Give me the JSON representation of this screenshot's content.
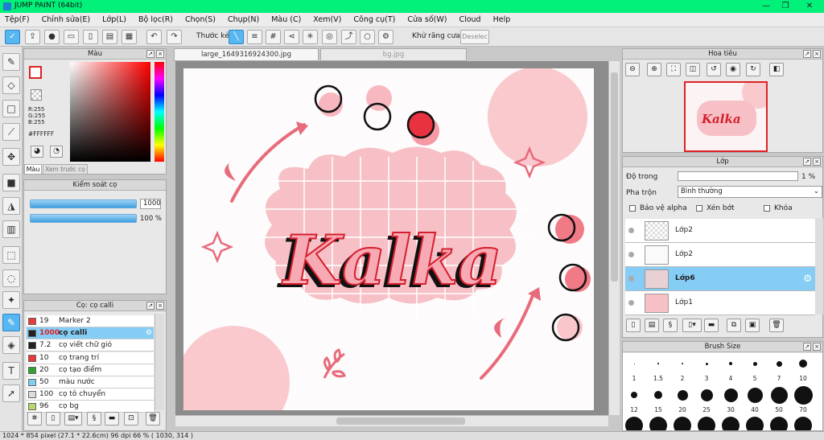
{
  "window": {
    "title": "JUMP PAINT (64bit)"
  },
  "menu": [
    "Tệp(F)",
    "Chỉnh sửa(E)",
    "Lớp(L)",
    "Bộ lọc(R)",
    "Chọn(S)",
    "Chụp(N)",
    "Màu (C)",
    "Xem(V)",
    "Công cụ(T)",
    "Cửa số(W)",
    "Cloud",
    "Help"
  ],
  "toolbar": {
    "ruler_label": "Thước kẻ",
    "antialias_label": "Khử răng cưa",
    "deselect_label": "Deselec"
  },
  "tabs": {
    "active": "large_1649316924300.jpg",
    "inactive": "bg.jpg"
  },
  "color_panel": {
    "title": "Màu",
    "r": "R:255",
    "g": "G:255",
    "b": "B:255",
    "hex": "#FFFFFF",
    "tab1": "Màu",
    "tab2": "Xem trước cọ"
  },
  "brush_control": {
    "title": "Kiểm soát cọ",
    "size": "1000",
    "opacity": "100 %"
  },
  "brush_list": {
    "title": "Cọ: cọ calli",
    "items": [
      {
        "size": "19",
        "name": "Marker 2",
        "color": "#e83a3a"
      },
      {
        "size": "1000",
        "name": "cọ calli",
        "color": "#222222"
      },
      {
        "size": "7.2",
        "name": "cọ viết chữ gió",
        "color": "#222222"
      },
      {
        "size": "10",
        "name": "cọ trang trí",
        "color": "#e83a3a"
      },
      {
        "size": "20",
        "name": "cọ tạo điểm",
        "color": "#2ea12e"
      },
      {
        "size": "50",
        "name": "màu nước",
        "color": "#7fd0f0"
      },
      {
        "size": "100",
        "name": "cọ tô chuyển",
        "color": "#dddddd"
      },
      {
        "size": "96",
        "name": "cọ bg",
        "color": "#b8d86a"
      }
    ]
  },
  "navigator": {
    "title": "Hoa tiêu",
    "thumb_text": "Kalka"
  },
  "layer_panel": {
    "title": "Lớp",
    "opacity_label": "Độ trong",
    "opacity_value": "1 %",
    "blend_label": "Pha trộn",
    "blend_value": "Bình thường",
    "opt1": "Bảo vệ alpha",
    "opt2": "Xén bớt",
    "opt3": "Khóa",
    "layers": [
      {
        "name": "Lớp2"
      },
      {
        "name": "Lớp2"
      },
      {
        "name": "Lớp6"
      },
      {
        "name": "Lớp1"
      }
    ]
  },
  "brush_size": {
    "title": "Brush Size",
    "row1": [
      "1",
      "1.5",
      "2",
      "3",
      "4",
      "5",
      "7",
      "10"
    ],
    "row2": [
      "12",
      "15",
      "20",
      "25",
      "30",
      "40",
      "50",
      "70"
    ]
  },
  "canvas": {
    "art_text": "Kalka"
  },
  "status": "1024 * 854 pixel   (27.1 * 22.6cm)  96 dpi  66 %  ( 1030, 314 )",
  "colors": {
    "title_green": "#00f07a",
    "accent_blue": "#58b6f0",
    "art_pink": "#f7c6cc",
    "art_red": "#e0202e"
  }
}
